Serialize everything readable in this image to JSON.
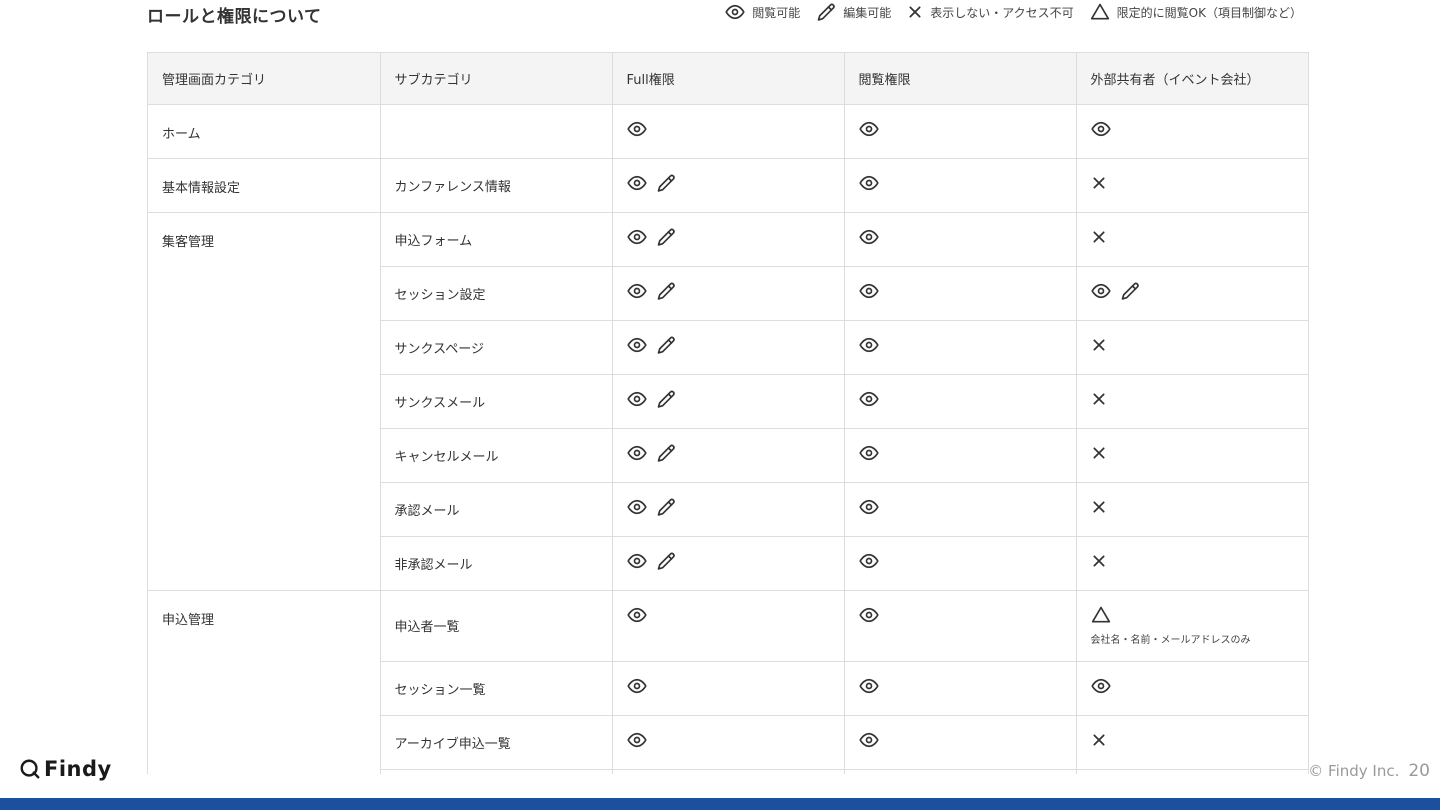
{
  "page": {
    "title": "ロールと権限について"
  },
  "legend": [
    {
      "icon": "eye-icon",
      "label": "閲覧可能"
    },
    {
      "icon": "pencil-icon",
      "label": "編集可能"
    },
    {
      "icon": "cross-icon",
      "label": "表示しない・アクセス不可"
    },
    {
      "icon": "triangle-icon",
      "label": "限定的に閲覧OK（項目制御など）"
    }
  ],
  "table": {
    "headers": [
      "管理画面カテゴリ",
      "サブカテゴリ",
      "Full権限",
      "閲覧権限",
      "外部共有者（イベント会社）"
    ],
    "rows": [
      {
        "category": "ホーム",
        "sub": "",
        "full": "view",
        "view": "view",
        "external": "view"
      },
      {
        "category": "基本情報設定",
        "sub": "カンファレンス情報",
        "full": "view-edit",
        "view": "view",
        "external": "none"
      },
      {
        "category": "集客管理",
        "rowspan": 7,
        "sub": "申込フォーム",
        "full": "view-edit",
        "view": "view",
        "external": "none"
      },
      {
        "sub": "セッション設定",
        "full": "view-edit",
        "view": "view",
        "external": "view-edit"
      },
      {
        "sub": "サンクスページ",
        "full": "view-edit",
        "view": "view",
        "external": "none"
      },
      {
        "sub": "サンクスメール",
        "full": "view-edit",
        "view": "view",
        "external": "none"
      },
      {
        "sub": "キャンセルメール",
        "full": "view-edit",
        "view": "view",
        "external": "none"
      },
      {
        "sub": "承認メール",
        "full": "view-edit",
        "view": "view",
        "external": "none"
      },
      {
        "sub": "非承認メール",
        "full": "view-edit",
        "view": "view",
        "external": "none"
      },
      {
        "category": "申込管理",
        "rowspan": 4,
        "sub": "申込者一覧",
        "full": "view",
        "view": "view",
        "external": "limited",
        "external_note": "会社名・名前・メールアドレスのみ",
        "tall": true
      },
      {
        "sub": "セッション一覧",
        "full": "view",
        "view": "view",
        "external": "view"
      },
      {
        "sub": "アーカイブ申込一覧",
        "full": "view",
        "view": "view",
        "external": "none"
      },
      {
        "sub": "",
        "full": "",
        "view": "",
        "external": ""
      }
    ]
  },
  "footer": {
    "logo": "Findy",
    "copyright": "© Findy Inc.",
    "page_number": "20"
  },
  "colors": {
    "accent_bar": "#1c4f9c",
    "header_bg": "#f4f4f4",
    "border": "#dddddd",
    "icon": "#333333"
  }
}
